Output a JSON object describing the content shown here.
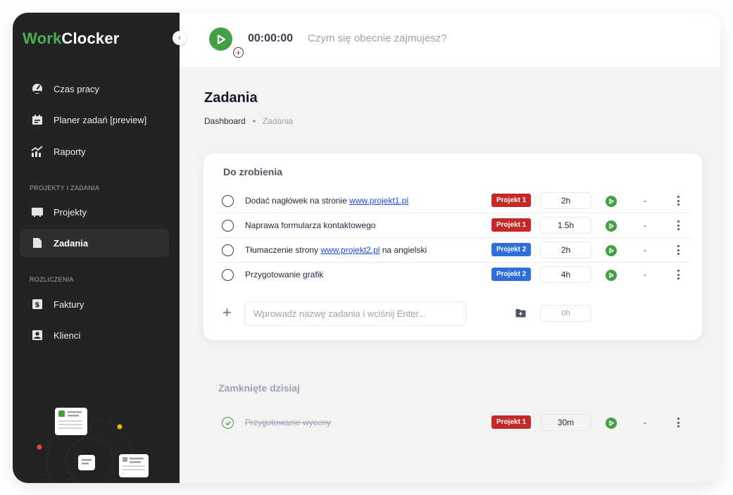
{
  "app": {
    "logo_work": "Work",
    "logo_clocker": "Clocker"
  },
  "sidebar": {
    "items": [
      {
        "label": "Czas pracy",
        "icon": "speedometer-icon"
      },
      {
        "label": "Planer zadań [preview]",
        "icon": "calendar-icon"
      },
      {
        "label": "Raporty",
        "icon": "chart-icon"
      }
    ],
    "section_projects": "PROJEKTY I ZADANIA",
    "projects_items": [
      {
        "label": "Projekty",
        "icon": "monitor-icon"
      },
      {
        "label": "Zadania",
        "icon": "document-icon",
        "active": true
      }
    ],
    "section_billing": "ROZLICZENIA",
    "billing_items": [
      {
        "label": "Faktury",
        "icon": "dollar-icon"
      },
      {
        "label": "Klienci",
        "icon": "user-icon"
      }
    ]
  },
  "header": {
    "timer": "00:00:00",
    "prompt": "Czym się obecnie zajmujesz?"
  },
  "page": {
    "title": "Zadania",
    "breadcrumb": {
      "home": "Dashboard",
      "current": "Zadania"
    }
  },
  "todo": {
    "title": "Do zrobienia",
    "tasks": [
      {
        "text": "Dodać nagłówek na stronie ",
        "link": "www.projekt1.pl",
        "text_after": "",
        "project": "Projekt 1",
        "project_color": "#c62828",
        "time": "2h",
        "spent": "-"
      },
      {
        "text": "Naprawa formularza kontaktowego",
        "link": "",
        "text_after": "",
        "project": "Projekt 1",
        "project_color": "#c62828",
        "time": "1.5h",
        "spent": "-"
      },
      {
        "text": "Tłumaczenie strony ",
        "link": "www.projekt2.pl",
        "text_after": " na angielski",
        "project": "Projekt 2",
        "project_color": "#2f6fdb",
        "time": "2h",
        "spent": "-"
      },
      {
        "text": "Przygotowanie grafik",
        "link": "",
        "text_after": "",
        "project": "Projekt 2",
        "project_color": "#2f6fdb",
        "time": "4h",
        "spent": "-"
      }
    ],
    "new_task_placeholder": "Wprowadź nazwę zadania i wciśnij Enter...",
    "new_task_time": "0h"
  },
  "closed": {
    "title": "Zamknięte dzisiaj",
    "tasks": [
      {
        "text": "Przygotowanie wyceny",
        "project": "Projekt 1",
        "project_color": "#c62828",
        "time": "30m",
        "spent": "-"
      }
    ]
  },
  "colors": {
    "accent": "#43a047",
    "sidebar_bg": "#232323",
    "project1": "#c62828",
    "project2": "#2f6fdb"
  }
}
